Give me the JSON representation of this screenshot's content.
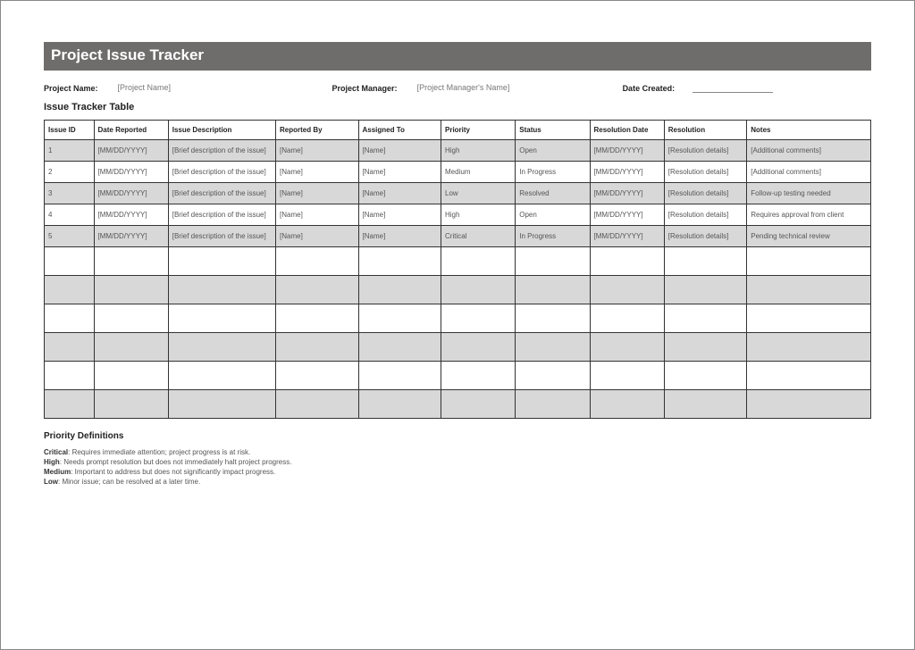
{
  "title": "Project Issue Tracker",
  "meta": {
    "projectNameLabel": "Project Name:",
    "projectNameValue": "[Project Name]",
    "projectManagerLabel": "Project Manager:",
    "projectManagerValue": "[Project Manager's Name]",
    "dateCreatedLabel": "Date Created:"
  },
  "tableHeading": "Issue Tracker Table",
  "columns": {
    "id": "Issue ID",
    "dateReported": "Date Reported",
    "description": "Issue Description",
    "reportedBy": "Reported By",
    "assignedTo": "Assigned To",
    "priority": "Priority",
    "status": "Status",
    "resolutionDate": "Resolution Date",
    "resolution": "Resolution",
    "notes": "Notes"
  },
  "rows": [
    {
      "id": "1",
      "dateReported": "[MM/DD/YYYY]",
      "description": "[Brief description of the issue]",
      "reportedBy": "[Name]",
      "assignedTo": "[Name]",
      "priority": "High",
      "status": "Open",
      "resolutionDate": "[MM/DD/YYYY]",
      "resolution": "[Resolution details]",
      "notes": "[Additional comments]"
    },
    {
      "id": "2",
      "dateReported": "[MM/DD/YYYY]",
      "description": "[Brief description of the issue]",
      "reportedBy": "[Name]",
      "assignedTo": "[Name]",
      "priority": "Medium",
      "status": "In Progress",
      "resolutionDate": "[MM/DD/YYYY]",
      "resolution": "[Resolution details]",
      "notes": "[Additional comments]"
    },
    {
      "id": "3",
      "dateReported": "[MM/DD/YYYY]",
      "description": "[Brief description of the issue]",
      "reportedBy": "[Name]",
      "assignedTo": "[Name]",
      "priority": "Low",
      "status": "Resolved",
      "resolutionDate": "[MM/DD/YYYY]",
      "resolution": "[Resolution details]",
      "notes": "Follow-up testing needed"
    },
    {
      "id": "4",
      "dateReported": "[MM/DD/YYYY]",
      "description": "[Brief description of the issue]",
      "reportedBy": "[Name]",
      "assignedTo": "[Name]",
      "priority": "High",
      "status": "Open",
      "resolutionDate": "[MM/DD/YYYY]",
      "resolution": "[Resolution details]",
      "notes": "Requires approval from client"
    },
    {
      "id": "5",
      "dateReported": "[MM/DD/YYYY]",
      "description": "[Brief description of the issue]",
      "reportedBy": "[Name]",
      "assignedTo": "[Name]",
      "priority": "Critical",
      "status": "In Progress",
      "resolutionDate": "[MM/DD/YYYY]",
      "resolution": "[Resolution details]",
      "notes": "Pending technical review"
    }
  ],
  "emptyRowCount": 6,
  "definitions": {
    "heading": "Priority Definitions",
    "items": [
      {
        "label": "Critical",
        "text": ": Requires immediate attention; project progress is at risk."
      },
      {
        "label": "High",
        "text": ": Needs prompt resolution but does not immediately halt project progress."
      },
      {
        "label": "Medium",
        "text": ": Important to address but does not significantly impact progress."
      },
      {
        "label": "Low",
        "text": ": Minor issue; can be resolved at a later time."
      }
    ]
  }
}
